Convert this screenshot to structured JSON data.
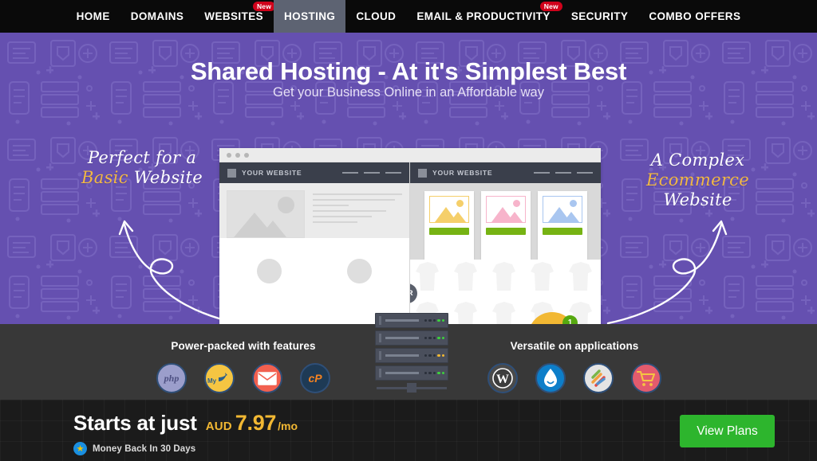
{
  "nav": {
    "items": [
      {
        "label": "HOME",
        "active": false,
        "badge": null
      },
      {
        "label": "DOMAINS",
        "active": false,
        "badge": null
      },
      {
        "label": "WEBSITES",
        "active": false,
        "badge": "New"
      },
      {
        "label": "HOSTING",
        "active": true,
        "badge": null
      },
      {
        "label": "CLOUD",
        "active": false,
        "badge": null
      },
      {
        "label": "EMAIL & PRODUCTIVITY",
        "active": false,
        "badge": "New"
      },
      {
        "label": "SECURITY",
        "active": false,
        "badge": null
      },
      {
        "label": "COMBO OFFERS",
        "active": false,
        "badge": null
      }
    ]
  },
  "hero": {
    "title": "Shared Hosting - At it's Simplest Best",
    "subtitle": "Get your Business Online in an Affordable way",
    "callout_left": {
      "line1": "Perfect for a",
      "accent": "Basic",
      "line2_rest": "Website"
    },
    "callout_right": {
      "line1": "A Complex",
      "accent": "Ecommerce",
      "line2_rest": "Website"
    },
    "or_label": "OR",
    "cart_count": "1"
  },
  "mockup": {
    "site_name_left": "YOUR WEBSITE",
    "site_name_right": "YOUR WEBSITE",
    "card_colors": [
      "#f5cf6a",
      "#f7b4cb",
      "#a9c6f0"
    ]
  },
  "features": {
    "left": {
      "title": "Power-packed with features",
      "icons": [
        {
          "name": "php-icon",
          "label": "php",
          "bg": "#9b9ecb",
          "fg": "#4d5082"
        },
        {
          "name": "mysql-icon",
          "label": "MySQL",
          "bg": "#f5c542",
          "fg": "#2b5f8a"
        },
        {
          "name": "email-icon",
          "label": "",
          "bg": "#f2604f",
          "fg": "#ffffff"
        },
        {
          "name": "cpanel-icon",
          "label": "cP",
          "bg": "#1e3a55",
          "fg": "#f58220"
        }
      ]
    },
    "right": {
      "title": "Versatile on applications",
      "icons": [
        {
          "name": "wordpress-icon",
          "label": "W",
          "bg": "#4a4a4a",
          "fg": "#ffffff"
        },
        {
          "name": "drupal-icon",
          "label": "",
          "bg": "#0d7ec9",
          "fg": "#ffffff"
        },
        {
          "name": "joomla-icon",
          "label": "",
          "bg": "#e4e4e4",
          "fg": "#5091cd"
        },
        {
          "name": "ecommerce-cart-icon",
          "label": "",
          "bg": "#e35b6d",
          "fg": "#f5c542"
        }
      ]
    }
  },
  "pricing": {
    "starts_label": "Starts at just",
    "currency": "AUD",
    "amount": "7.97",
    "period": "/mo",
    "guarantee": "Money Back In 30 Days",
    "cta_label": "View Plans",
    "accent_color": "#f2b833",
    "cta_color": "#2db52d"
  }
}
